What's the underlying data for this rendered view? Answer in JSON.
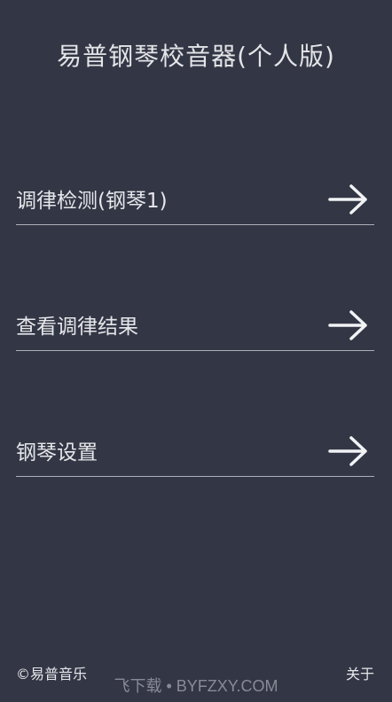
{
  "app": {
    "title": "易普钢琴校音器(个人版)"
  },
  "menu": [
    {
      "label": "调律检测(钢琴1)",
      "icon": "arrow-right-icon"
    },
    {
      "label": "查看调律结果",
      "icon": "arrow-right-icon"
    },
    {
      "label": "钢琴设置",
      "icon": "arrow-right-icon"
    }
  ],
  "footer": {
    "copyright": "©易普音乐",
    "about": "关于"
  },
  "watermark": {
    "text": "飞下载 • BYFZXY.COM"
  },
  "colors": {
    "background": "#333645",
    "text": "#e6e7ea",
    "divider": "#aeb0b8"
  }
}
